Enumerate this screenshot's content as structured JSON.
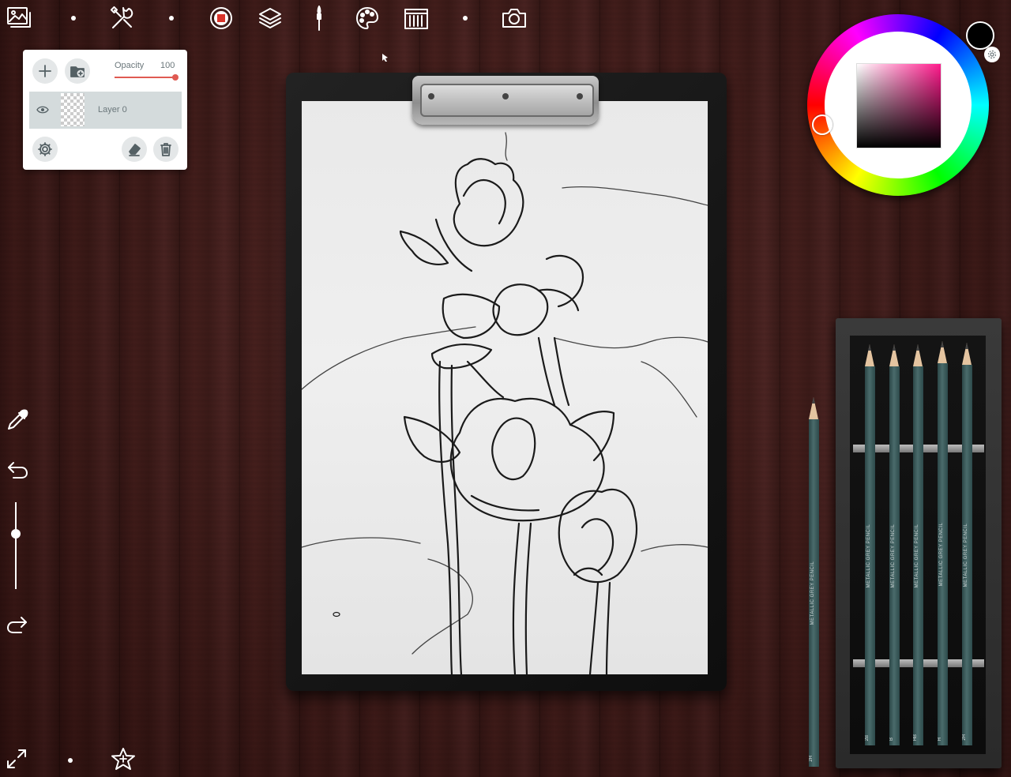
{
  "toolbar": {
    "icons": [
      "gallery-icon",
      "tools-icon",
      "brush-stroke-icon",
      "layers-icon",
      "brush-icon",
      "palette-icon",
      "brush-library-icon",
      "camera-icon"
    ]
  },
  "layers_panel": {
    "opacity_label": "Opacity",
    "opacity_value": "100",
    "opacity": 1.0,
    "layers": [
      {
        "name": "Layer 0",
        "visible": true
      }
    ]
  },
  "color": {
    "current": "#000000",
    "hue": "#ff1a8c"
  },
  "pencils": [
    {
      "label": "METALLIC GREY PENCIL",
      "grade": "2H"
    },
    {
      "label": "METALLIC GREY PENCIL",
      "grade": "2B"
    },
    {
      "label": "METALLIC GREY PENCIL",
      "grade": "B"
    },
    {
      "label": "METALLIC GREY PENCIL",
      "grade": "HB"
    },
    {
      "label": "METALLIC GREY PENCIL",
      "grade": "H"
    },
    {
      "label": "METALLIC GREY PENCIL",
      "grade": "2H"
    }
  ],
  "colors": {
    "accent": "#e05a52",
    "panel_bg": "#ffffff",
    "layer_selected": "#d4dbdc"
  }
}
